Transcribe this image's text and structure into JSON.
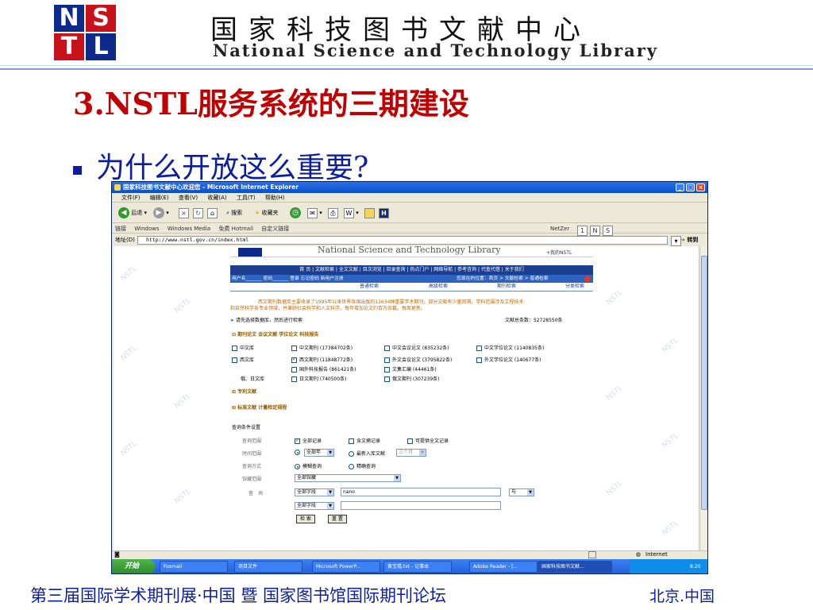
{
  "slide": {
    "library_name_cn": "国家科技图书文献中心",
    "library_name_en": "National Science and Technology Library",
    "logo_letters": [
      "N",
      "S",
      "T",
      "L"
    ],
    "title": "3.NSTL服务系统的三期建设",
    "bullet": "为什么开放这么重要?",
    "footer_left": "第三届国际学术期刊展·中国 暨 国家图书馆国际期刊论坛",
    "footer_right": "北京.中国"
  },
  "browser": {
    "window_title": "国家科技图书文献中心欢迎您 - Microsoft Internet Explorer",
    "menu": [
      "文件(F)",
      "编辑(E)",
      "查看(V)",
      "收藏(A)",
      "工具(T)",
      "帮助(H)"
    ],
    "toolbar": {
      "back": "后退",
      "search": "搜索",
      "favorites": "收藏夹"
    },
    "links_label": "链接",
    "links": [
      "Windows",
      "Windows Media",
      "免费 Hotmail",
      "自定义链接"
    ],
    "netzer": "NetZer",
    "address_label": "地址(D)",
    "address": "http://www.nstl.gov.cn/index.html",
    "go_label": "转到"
  },
  "site": {
    "banner_en": "National Science and Technology Library",
    "banner_right": "+我的NSTL",
    "nav": "首 页 | 文献检索 | 全文文献 | 目次浏览 | 目录查询 | 热点门户 | 网络导航 | 参考咨询 | 代查代借 | 关于我们",
    "userbar_left": "用户名_______ 密码_______ 登录 忘记密码 新用户注册",
    "userbar_right": "您现在的位置：首页 > 文献检索 > 普通检索",
    "tabs": [
      "普通检索",
      "高级检索",
      "期刊检索",
      "分类检索"
    ],
    "intro_line1": "西文期刊数据库主要收录了1995年以来世界各国出版的12634种重要学术期刊，部分文献有少量回溯。学科范围涉及工程技术",
    "intro_line2": "和自然科学各专业领域，并兼顾社会科学和人文科学。每年增加论文约百万余篇，每周更新。",
    "choose_db": "请先选择数据库，然后进行检索",
    "total_count": "文献总条数：52728550条",
    "group_title": "期刊论文 会议文献 学位论文 科技报告",
    "rows": [
      {
        "label": "中文库",
        "items": [
          "中文期刊 (17384702条)",
          "中文会议论文 (835232条)",
          "中文学位论文 (1140835条)"
        ]
      },
      {
        "label": "西文库",
        "items": [
          "西文期刊 (11848772条)",
          "外文会议论文 (3795822条)",
          "外文学位论文 (140677条)"
        ]
      },
      {
        "label": "",
        "items": [
          "国外科技报告 (861421条)",
          "文集汇编 (44461条)"
        ]
      },
      {
        "label": "俄、日文库",
        "items": [
          "日文期刊 (740500条)",
          "俄文期刊 (307239条)"
        ]
      }
    ],
    "patent": "专利文献",
    "standard": "标准文献 计量检定规程",
    "query_settings": "查询条件设置",
    "scope_label": "查询范围",
    "scope_opts": [
      "全部记录",
      "含文摘记录",
      "可提供全文记录"
    ],
    "time_label": "时间范围",
    "time_all": "全部年",
    "time_recent": "最新入库文献",
    "time_recent_val": "三个月",
    "mode_label": "查询方式",
    "mode_opts": [
      "模糊查询",
      "精确查询"
    ],
    "holding_label": "馆藏范围",
    "holding_val": "全部馆藏",
    "query_label": "查　询",
    "field1": "全部字段",
    "term1": "nano",
    "logic": "与",
    "field2": "全部字段",
    "search_btn": "检 索",
    "reset_btn": "重 置",
    "watermark": "NSTL"
  },
  "status": {
    "zone": "Internet"
  },
  "taskbar": {
    "start": "开始",
    "tasks": [
      "Foxmail",
      "项目文件",
      "Microsoft PowerP...",
      "黄宝禧.txt - 记事本",
      "Adobe Reader - [...",
      "国家科技图书文献..."
    ],
    "time": "8:20"
  }
}
